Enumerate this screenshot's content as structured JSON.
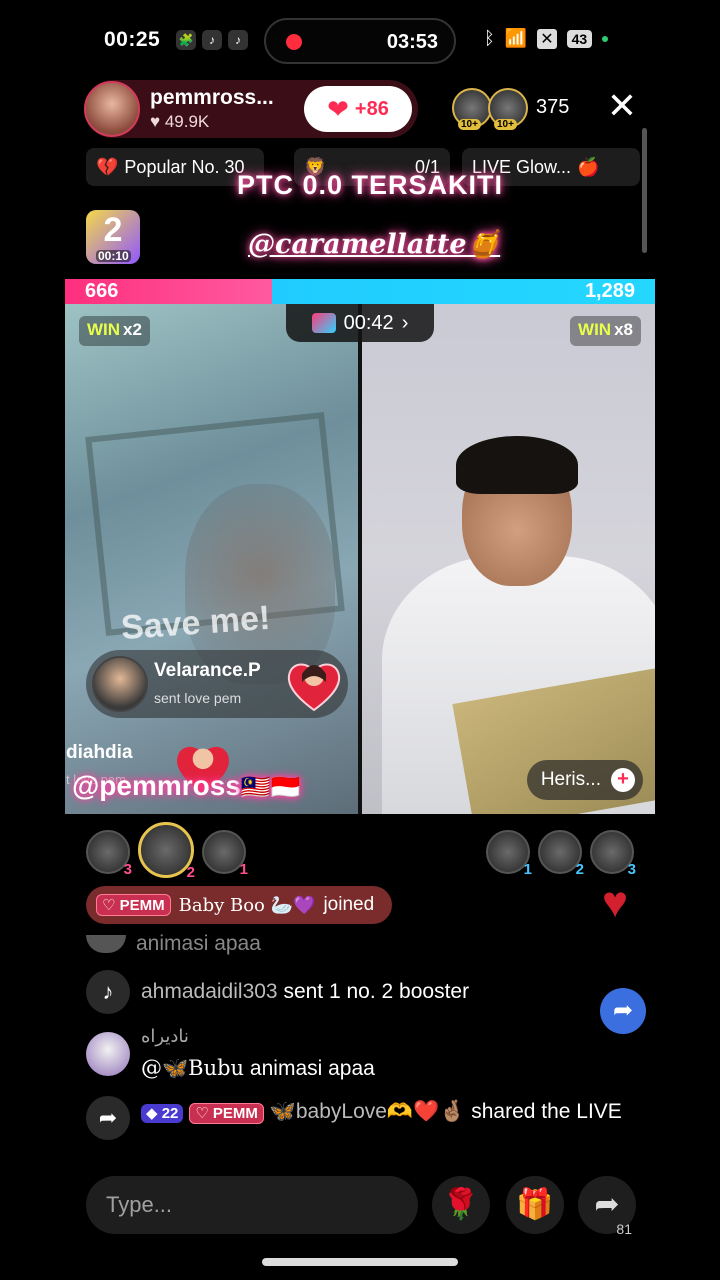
{
  "status": {
    "time": "00:25",
    "recording_time": "03:53",
    "battery": "43"
  },
  "host": {
    "name": "pemmross...",
    "likes": "49.9K",
    "follow_count": "+86"
  },
  "viewers": {
    "count": "375",
    "badges": [
      "10+",
      "10+"
    ]
  },
  "chips": {
    "popular": "Popular No. 30",
    "goal": "0/1",
    "glow": "LIVE Glow..."
  },
  "overlay": {
    "title": "PTC 0.0 TERSAKITI",
    "handle": "@caramellatte🍯",
    "level_timer": "00:10",
    "level_number": "2"
  },
  "battle": {
    "left_score": "666",
    "right_score": "1,289",
    "left_share": 0.35,
    "timer": "00:42",
    "left_win_label": "WIN",
    "left_win_mult": "x2",
    "right_win_label": "WIN",
    "right_win_mult": "x8",
    "left_caption": "Save me!",
    "guest_name": "Heris..."
  },
  "gift_toast": {
    "sender": "Velarance.P",
    "description": "sent love pem",
    "second_sender": "diahdia",
    "second_sub": "t love pem"
  },
  "watermark": {
    "handle": "@pemmross",
    "flags": "🇲🇾🇮🇩"
  },
  "contributors": {
    "left_ranks": [
      "3",
      "2",
      "1"
    ],
    "right_ranks": [
      "1",
      "2",
      "3"
    ]
  },
  "joined_banner": {
    "tag": "PEMM",
    "name": "Baby Boo 🦢💜",
    "action": "joined"
  },
  "chat": {
    "faded_msg": "animasi apaa",
    "system_user": "ahmadaidil303",
    "system_text": "sent 1 no. 2 booster",
    "user_name": "ناديراه",
    "mention": "@🦋Bubu",
    "message": "animasi apaa",
    "share_level": "22",
    "share_tag": "PEMM",
    "share_user": "🦋babyLove🫶❤️🤞🏽",
    "share_text": "shared the LIVE"
  },
  "bottom": {
    "placeholder": "Type...",
    "share_count": "81"
  },
  "colors": {
    "accent": "#fe2c55",
    "battle_left": "#ff2f7e",
    "battle_right": "#24d7ff",
    "win_text": "#e9ff4a"
  }
}
